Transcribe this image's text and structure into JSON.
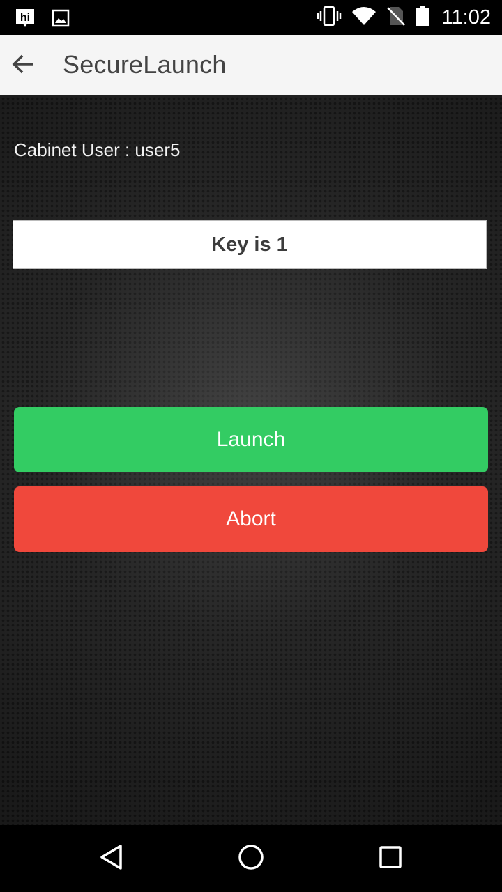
{
  "status_bar": {
    "time": "11:02",
    "notification_icons": [
      "hi-app-icon",
      "image-icon"
    ],
    "system_icons": [
      "vibrate-icon",
      "wifi-icon",
      "no-sim-icon",
      "battery-icon"
    ]
  },
  "app_bar": {
    "title": "SecureLaunch",
    "back_icon": "arrow-back-icon"
  },
  "main": {
    "cabinet_user": "Cabinet User : user5",
    "key_status": "Key is 1",
    "launch_label": "Launch",
    "abort_label": "Abort"
  },
  "nav_bar": {
    "icons": [
      "back-triangle-icon",
      "home-circle-icon",
      "recents-square-icon"
    ]
  },
  "colors": {
    "launch": "#33cc63",
    "abort": "#f0483c",
    "app_bar_bg": "#f5f5f5",
    "status_bar_bg": "#000000"
  }
}
